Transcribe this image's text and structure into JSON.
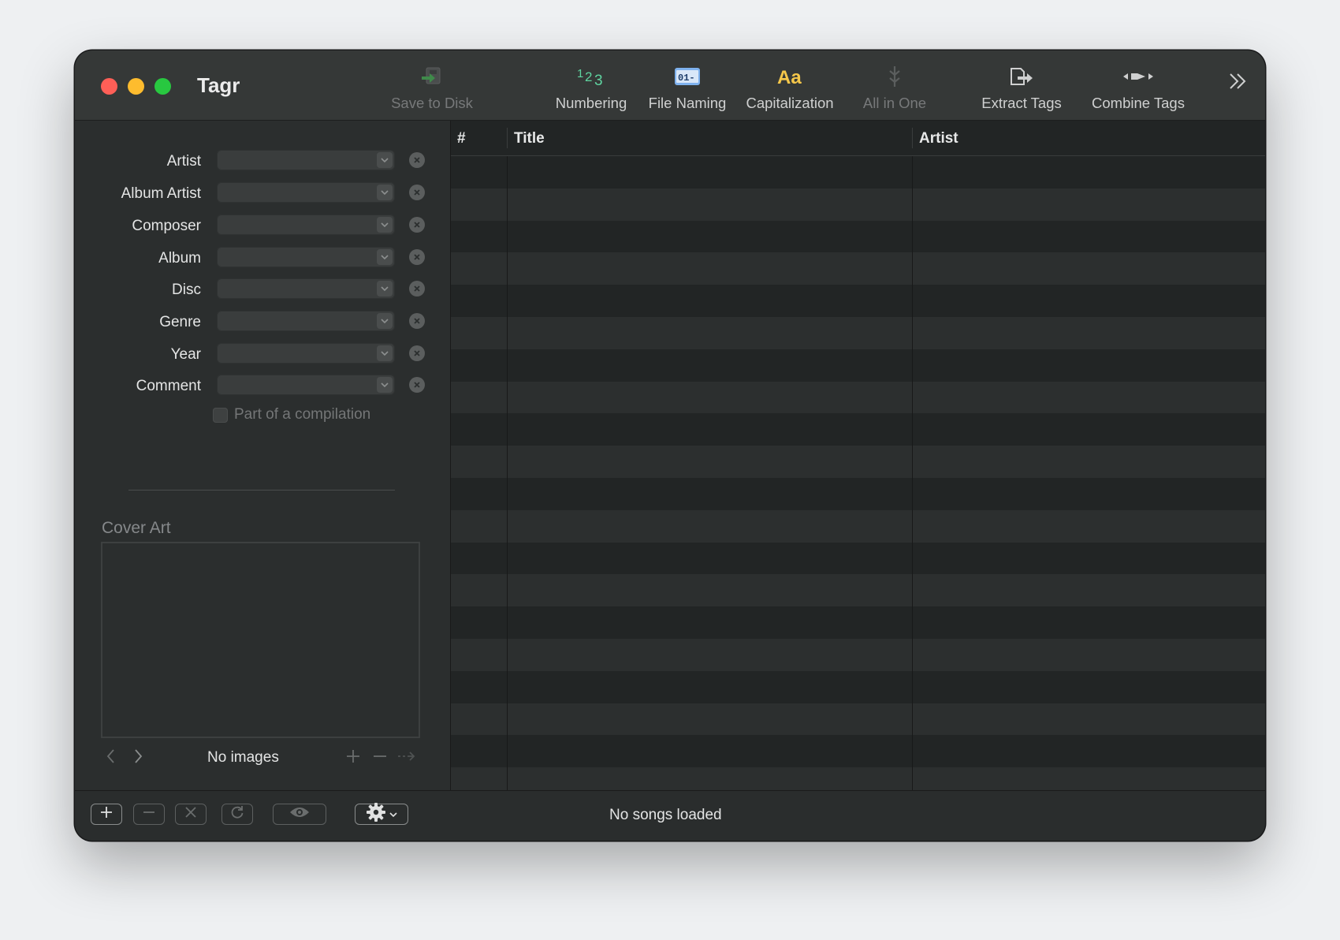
{
  "window": {
    "title": "Tagr"
  },
  "toolbar": {
    "items": [
      {
        "label": "Save to Disk",
        "icon": "save-to-disk-icon",
        "enabled": false
      },
      {
        "label": "Numbering",
        "icon": "numbering-icon",
        "glyph": "123",
        "enabled": true
      },
      {
        "label": "File Naming",
        "icon": "file-naming-icon",
        "glyph": "01-",
        "enabled": true
      },
      {
        "label": "Capitalization",
        "icon": "capitalization-icon",
        "glyph": "Aa",
        "enabled": true
      },
      {
        "label": "All in One",
        "icon": "all-in-one-icon",
        "enabled": false
      },
      {
        "label": "Extract Tags",
        "icon": "extract-tags-icon",
        "enabled": true
      },
      {
        "label": "Combine Tags",
        "icon": "combine-tags-icon",
        "enabled": true
      }
    ],
    "overflow_icon": "chevron-double-right-icon"
  },
  "inspector": {
    "fields": [
      {
        "label": "Artist",
        "value": ""
      },
      {
        "label": "Album Artist",
        "value": ""
      },
      {
        "label": "Composer",
        "value": ""
      },
      {
        "label": "Album",
        "value": ""
      },
      {
        "label": "Disc",
        "value": ""
      },
      {
        "label": "Genre",
        "value": ""
      },
      {
        "label": "Year",
        "value": ""
      },
      {
        "label": "Comment",
        "value": ""
      }
    ],
    "compilation_label": "Part of a compilation",
    "compilation_checked": false,
    "cover_art": {
      "title": "Cover Art",
      "status": "No images"
    }
  },
  "table": {
    "columns": [
      {
        "label": "#"
      },
      {
        "label": "Title"
      },
      {
        "label": "Artist"
      }
    ],
    "rows": []
  },
  "bottombar": {
    "status": "No songs loaded",
    "buttons": [
      "add-icon",
      "remove-icon",
      "clear-icon",
      "reload-icon",
      "preview-eye-icon",
      "gear-icon"
    ]
  },
  "colors": {
    "window_bg": "#2b2e2e",
    "titlebar_bg": "#353837",
    "close": "#fe5f57",
    "minimize": "#febc2e",
    "maximize": "#28c840",
    "numbering_green": "#5fd4a0",
    "file_naming_blue": "#7fb2ee",
    "capitalization_yellow": "#f5c74a"
  }
}
